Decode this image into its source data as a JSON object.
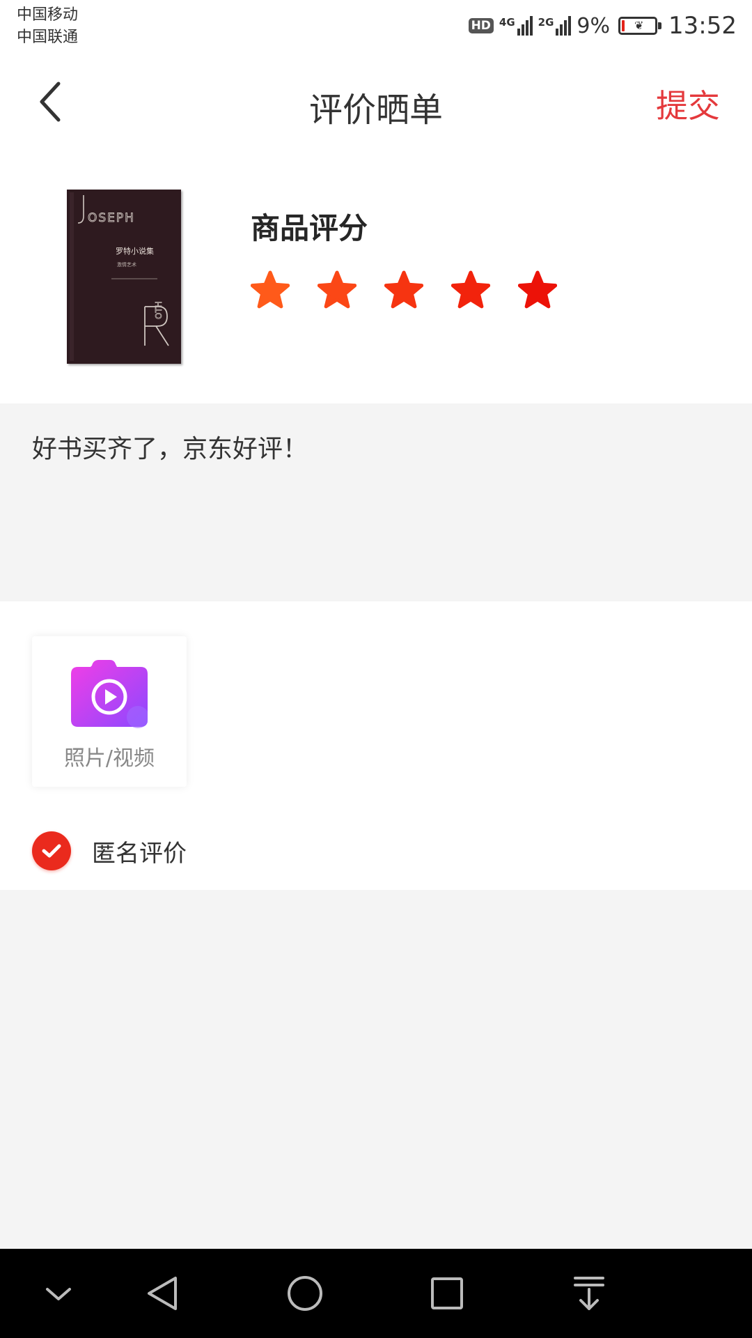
{
  "status_bar": {
    "carrier_1": "中国移动",
    "carrier_2": "中国联通",
    "hd_badge": "HD",
    "network_1": "4G",
    "network_2": "2G",
    "battery_percent": "9%",
    "battery_level": 0.09,
    "time": "13:52"
  },
  "header": {
    "title": "评价晒单",
    "submit_label": "提交",
    "back_icon": "chevron-left-icon"
  },
  "product": {
    "cover_title": "罗特小说集",
    "cover_subtitle": "激情艺术",
    "rating_label": "商品评分",
    "rating": 5,
    "max_rating": 5,
    "star_colors": [
      "#ff5a1a",
      "#fb4716",
      "#f63411",
      "#f2230c",
      "#ec1208"
    ]
  },
  "comment": {
    "text": "好书买齐了，京东好评！"
  },
  "upload": {
    "label": "照片/视频",
    "icon": "camera-video-icon"
  },
  "anonymous": {
    "label": "匿名评价",
    "checked": true
  },
  "nav_bar": {
    "buttons": [
      "collapse-icon",
      "back-triangle-icon",
      "home-circle-icon",
      "recents-square-icon",
      "notification-pull-icon"
    ]
  },
  "colors": {
    "accent": "#e4393c",
    "check": "#ea2a1d",
    "book": "#2e1a1f"
  }
}
